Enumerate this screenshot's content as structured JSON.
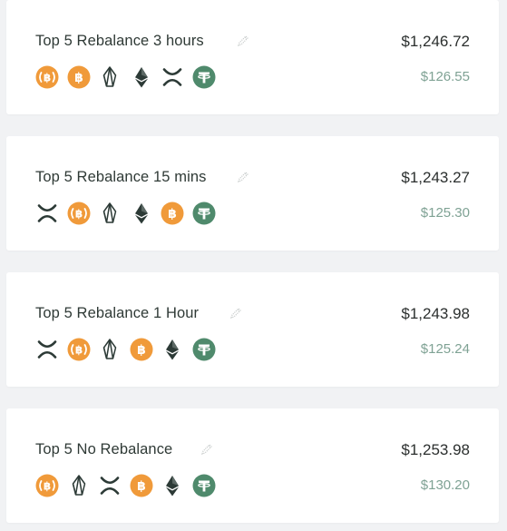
{
  "portfolios": [
    {
      "name": "Top 5 Rebalance 3 hours",
      "value": "$1,246.72",
      "change": "$126.55",
      "assets": [
        "bitcoin-cash-icon",
        "bitcoin-icon",
        "eos-icon",
        "ethereum-icon",
        "xrp-icon",
        "tether-icon"
      ]
    },
    {
      "name": "Top 5 Rebalance 15 mins",
      "value": "$1,243.27",
      "change": "$125.30",
      "assets": [
        "xrp-icon",
        "bitcoin-cash-icon",
        "eos-icon",
        "ethereum-icon",
        "bitcoin-icon",
        "tether-icon"
      ]
    },
    {
      "name": "Top 5 Rebalance 1 Hour",
      "value": "$1,243.98",
      "change": "$125.24",
      "assets": [
        "xrp-icon",
        "bitcoin-cash-icon",
        "eos-icon",
        "bitcoin-icon",
        "ethereum-icon",
        "tether-icon"
      ]
    },
    {
      "name": "Top 5 No Rebalance",
      "value": "$1,253.98",
      "change": "$130.20",
      "assets": [
        "bitcoin-cash-icon",
        "eos-icon",
        "xrp-icon",
        "bitcoin-icon",
        "ethereum-icon",
        "tether-icon"
      ]
    }
  ],
  "colors": {
    "bitcoin": "#f09a3a",
    "bitcoin_cash": "#f09a3a",
    "tether": "#4f8a6c",
    "dark_icon": "#2c3a36",
    "change_text": "#7fa294"
  }
}
